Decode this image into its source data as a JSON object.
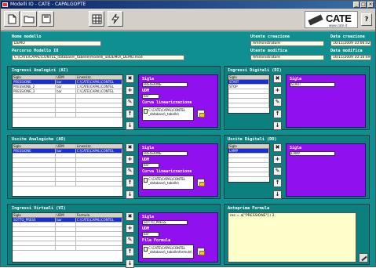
{
  "window": {
    "title": "Modelli IO - CATE - CAPALGOPTE"
  },
  "toolbar": {
    "icons": [
      "new-document-icon",
      "open-folder-icon",
      "save-icon",
      "grid-icon",
      "lightning-icon"
    ]
  },
  "logo": {
    "brand": "CATE",
    "url": "www.cate.it"
  },
  "help_label": "?",
  "header": {
    "nome_label": "Nome modello",
    "nome_value": "DEMO",
    "percorso_label": "Percorso Modello IO",
    "percorso_value": "C:\\CATE\\CAPAL\\CONTEL_database\\_tabelle\\modelli_io\\DEMO\\_DEMO.mod",
    "utente_creazione_label": "Utente creazione",
    "utente_creazione_value": "Amministratore",
    "data_creazione_label": "Data creazione",
    "data_creazione_value": "16/11/2009 10:06:02",
    "utente_modifica_label": "Utente modifica",
    "utente_modifica_value": "Amministratore",
    "data_modifica_label": "Data modifica",
    "data_modifica_value": "16/11/2009 10:16:49"
  },
  "ingressi_analogici": {
    "title": "Ingressi Analogici (AI)",
    "headers": [
      "Sigla",
      "UDM",
      "Linearizz."
    ],
    "rows": [
      [
        "PRESSIONE",
        "bar",
        "C:\\CATE\\CAPAL\\CONTEL"
      ],
      [
        "PRESSIONE_2",
        "bar",
        "C:\\CATE\\CAPAL\\CONTEL"
      ],
      [
        "PRESSIONE_3",
        "bar",
        "C:\\CATE\\CAPAL\\CONTEL"
      ]
    ],
    "sigla_label": "Sigla",
    "sigla_value": "PRESSIONE",
    "udm_label": "UDM",
    "udm_value": "bar",
    "curva_label": "Curva linearizzazione",
    "curva_value": "C:\\CATE\\CAPAL\\CONTEL _database\\_tabelle\\"
  },
  "ingressi_digitali": {
    "title": "Ingressi Digitali (DI)",
    "headers": [
      "Sigla"
    ],
    "rows": [
      [
        "START"
      ],
      [
        "STOP"
      ]
    ],
    "sigla_label": "Sigla",
    "sigla_value": "START"
  },
  "uscite_analogiche": {
    "title": "Uscite Analogiche (AO)",
    "headers": [
      "Sigla",
      "UDM",
      "Linearizz."
    ],
    "rows": [
      [
        "PRESSIONE",
        "bar",
        "C:\\CATE\\CAPAL\\CONTEL"
      ]
    ],
    "sigla_label": "Sigla",
    "sigla_value": "PRESSIONE",
    "udm_label": "UDM",
    "udm_value": "bar",
    "curva_label": "Curva linearizzazione",
    "curva_value": "C:\\CATE\\CAPAL\\CONTEL _database\\_tabelle\\"
  },
  "uscite_digitali": {
    "title": "Uscite Digitali (DO)",
    "headers": [
      "Sigla"
    ],
    "rows": [
      [
        "LAMP"
      ]
    ],
    "sigla_label": "Sigla",
    "sigla_value": "LAMP"
  },
  "ingressi_virtuali": {
    "title": "Ingressi Virtuali (VI)",
    "headers": [
      "Sigla",
      "UDM",
      "Formula"
    ],
    "rows": [
      [
        "SOTTO_PRESS",
        "bar",
        "C:\\CATE\\CAPAL\\CONTEL"
      ]
    ],
    "sigla_label": "Sigla",
    "sigla_value": "SOTTO_PRESS",
    "udm_label": "UDM",
    "udm_value": "bar",
    "file_label": "File Formula",
    "file_value": "C:\\CATE\\CAPAL\\CONTEL _database\\_tabelle\\formule\\"
  },
  "anteprima": {
    "title": "Anteprima Formula",
    "text": "res = a[\"PRESSIONE\"] / 2"
  },
  "side_buttons": {
    "delete": "✖",
    "add": "+",
    "edit": "✎",
    "up": "↑",
    "down": "↓"
  }
}
